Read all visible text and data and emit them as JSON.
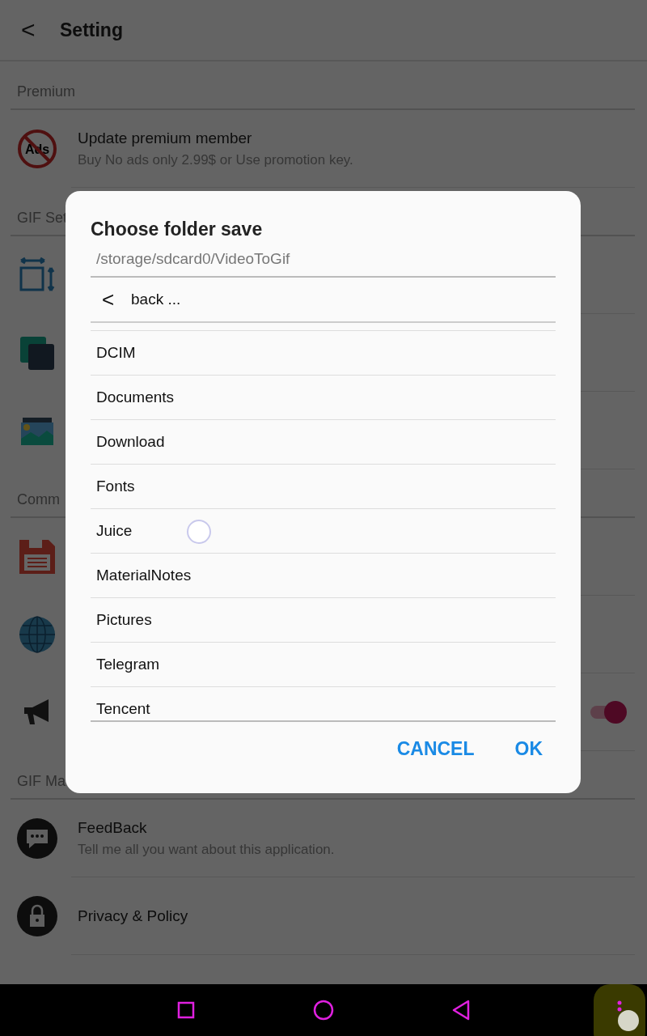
{
  "app_bar": {
    "back": "<",
    "title": "Setting"
  },
  "sections": [
    {
      "header": "Premium",
      "items": [
        {
          "kind": "text",
          "icon_text": "Ads",
          "title": "Update premium member",
          "subtitle": "Buy No ads only 2.99$ or Use promotion key."
        }
      ]
    },
    {
      "header": "GIF Set",
      "items": [
        {
          "kind": "icon_only"
        },
        {
          "kind": "icon_only"
        },
        {
          "kind": "icon_only"
        }
      ]
    },
    {
      "header": "Comm",
      "items": [
        {
          "kind": "icon_only"
        },
        {
          "kind": "icon_only"
        },
        {
          "kind": "toggle",
          "on": true
        }
      ]
    },
    {
      "header": "GIF Ma",
      "items": [
        {
          "title": "FeedBack",
          "subtitle": "Tell me all you want about this application."
        },
        {
          "title": "Privacy & Policy"
        }
      ]
    }
  ],
  "dialog": {
    "title": "Choose folder save",
    "path": "/storage/sdcard0/VideoToGif",
    "back": {
      "arrow": "<",
      "label": "back ..."
    },
    "folders": [
      {
        "name": "DCIM"
      },
      {
        "name": "Documents"
      },
      {
        "name": "Download"
      },
      {
        "name": "Fonts"
      },
      {
        "name": "Juice"
      },
      {
        "name": "MaterialNotes"
      },
      {
        "name": "Pictures"
      },
      {
        "name": "Telegram"
      },
      {
        "name": "Tencent"
      }
    ],
    "buttons": [
      "CANCEL",
      "OK"
    ]
  }
}
